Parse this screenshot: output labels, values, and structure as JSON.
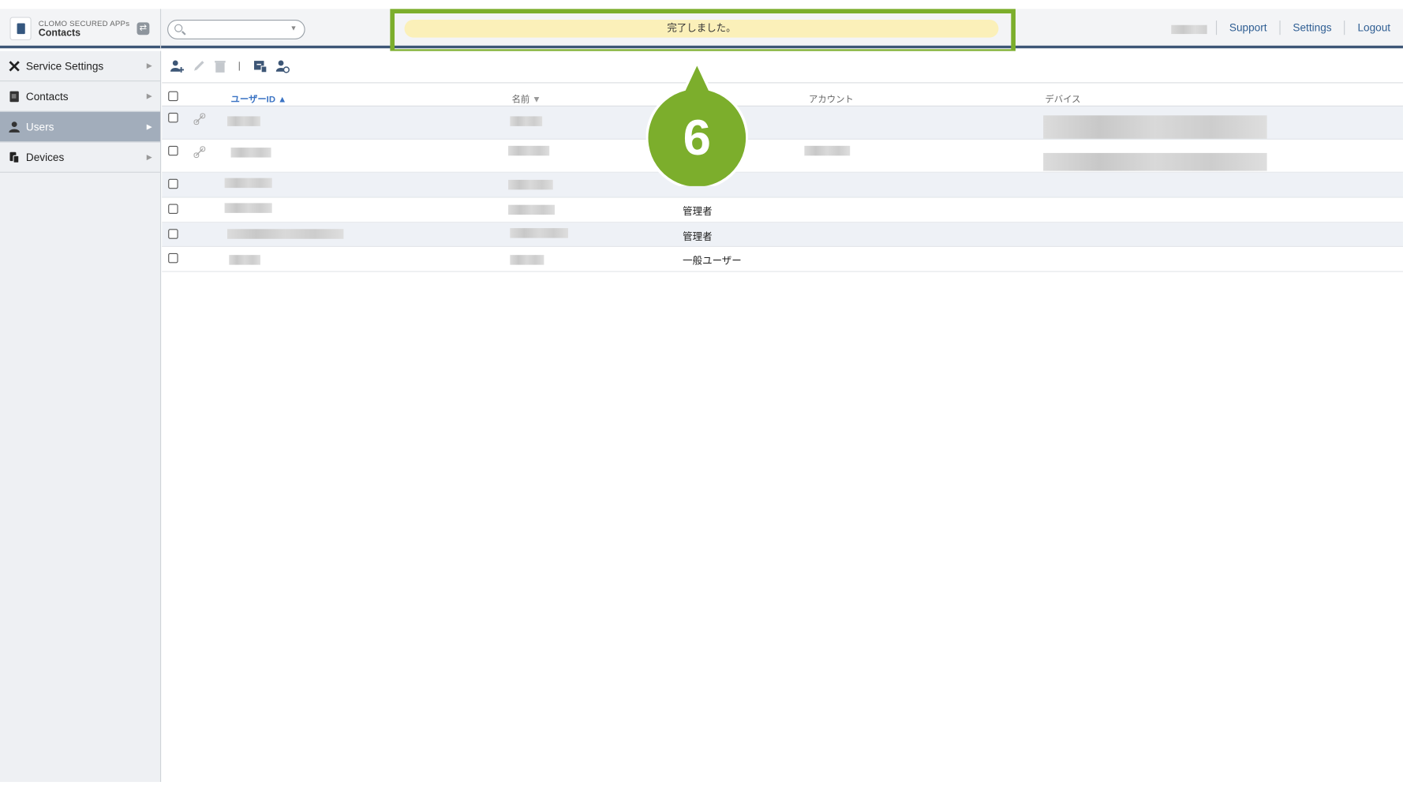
{
  "brand": {
    "line1": "CLOMO SECURED APPs",
    "line2": "Contacts"
  },
  "search": {
    "placeholder": ""
  },
  "notice": {
    "text": "完了しました。"
  },
  "nav": {
    "support": "Support",
    "settings": "Settings",
    "logout": "Logout"
  },
  "sidebar": {
    "items": [
      {
        "label": "Service Settings",
        "icon": "tools-icon",
        "active": false
      },
      {
        "label": "Contacts",
        "icon": "address-book-icon",
        "active": false
      },
      {
        "label": "Users",
        "icon": "user-icon",
        "active": true
      },
      {
        "label": "Devices",
        "icon": "devices-icon",
        "active": false
      }
    ]
  },
  "table": {
    "headers": {
      "user_id": "ユーザーID",
      "name": "名前",
      "account": "アカウント",
      "device": "デバイス"
    },
    "rows": [
      {
        "role": ""
      },
      {
        "role": ""
      },
      {
        "role": ""
      },
      {
        "role": "管理者"
      },
      {
        "role": "管理者"
      },
      {
        "role": "一般ユーザー"
      }
    ]
  },
  "callout": {
    "number": "6"
  },
  "colors": {
    "accent_green": "#7cae2c",
    "notice_bg": "#fbf0b9",
    "header_rule": "#3d5676",
    "link_blue": "#2f5e93"
  }
}
